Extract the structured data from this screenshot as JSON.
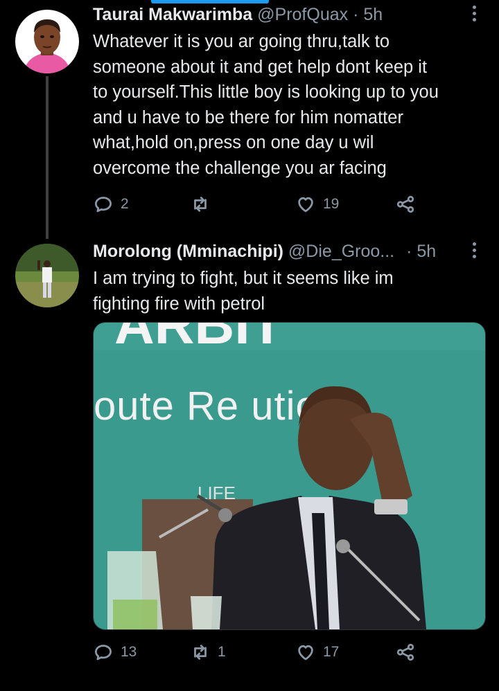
{
  "tweets": [
    {
      "name": "Taurai Makwarimba",
      "handle": "@ProfQuax",
      "separator": "·",
      "time": "5h",
      "text": "Whatever it is you ar going thru,talk to\nsomeone about it and get help dont keep it\nto yourself.This little boy is looking up to you\nand u have to be there for him nomatter\nwhat,hold on,press on one day u wil\novercome the challenge you ar facing",
      "replies": "2",
      "retweets": "",
      "likes": "19"
    },
    {
      "name": "Morolong (Mminachipi)",
      "handle": "@Die_Groo...",
      "separator": "·",
      "time": "5h",
      "text": "I am trying to fight, but it seems like im\nfighting fire with petrol",
      "media_text": "oute Re   utio",
      "media_text_top": "ARBIT",
      "media_text_lower": "LIFE",
      "replies": "13",
      "retweets": "1",
      "likes": "17"
    }
  ],
  "icons": [
    "more-icon",
    "reply-icon",
    "retweet-icon",
    "like-icon",
    "share-icon"
  ],
  "colors": {
    "background": "#000000",
    "text": "#e7e9ea",
    "muted": "#8b98a5",
    "thread": "#3e4144",
    "accent": "#1d9bf0",
    "media_bg": "#3a9a8e"
  }
}
